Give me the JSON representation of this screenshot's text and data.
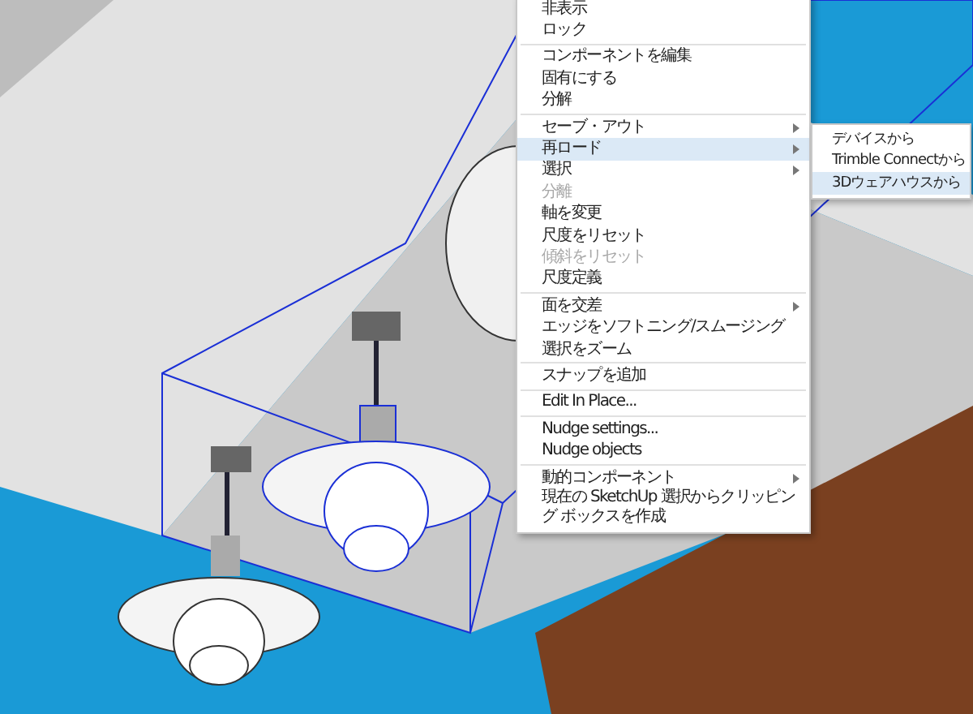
{
  "context_menu": {
    "items": [
      {
        "kind": "item",
        "label": "非表示",
        "submenu": false,
        "disabled": false,
        "selected": false
      },
      {
        "kind": "item",
        "label": "ロック",
        "submenu": false,
        "disabled": false,
        "selected": false
      },
      {
        "kind": "separator"
      },
      {
        "kind": "item",
        "label": "コンポーネントを編集",
        "submenu": false,
        "disabled": false,
        "selected": false
      },
      {
        "kind": "item",
        "label": "固有にする",
        "submenu": false,
        "disabled": false,
        "selected": false
      },
      {
        "kind": "item",
        "label": "分解",
        "submenu": false,
        "disabled": false,
        "selected": false
      },
      {
        "kind": "separator"
      },
      {
        "kind": "item",
        "label": "セーブ・アウト",
        "submenu": true,
        "disabled": false,
        "selected": false
      },
      {
        "kind": "item",
        "label": "再ロード",
        "submenu": true,
        "disabled": false,
        "selected": true
      },
      {
        "kind": "item",
        "label": "選択",
        "submenu": true,
        "disabled": false,
        "selected": false
      },
      {
        "kind": "item",
        "label": "分離",
        "submenu": false,
        "disabled": true,
        "selected": false
      },
      {
        "kind": "item",
        "label": "軸を変更",
        "submenu": false,
        "disabled": false,
        "selected": false
      },
      {
        "kind": "item",
        "label": "尺度をリセット",
        "submenu": false,
        "disabled": false,
        "selected": false
      },
      {
        "kind": "item",
        "label": "傾斜をリセット",
        "submenu": false,
        "disabled": true,
        "selected": false
      },
      {
        "kind": "item",
        "label": "尺度定義",
        "submenu": false,
        "disabled": false,
        "selected": false
      },
      {
        "kind": "separator"
      },
      {
        "kind": "item",
        "label": "面を交差",
        "submenu": true,
        "disabled": false,
        "selected": false
      },
      {
        "kind": "item",
        "label": "エッジをソフトニング/スムージング",
        "submenu": false,
        "disabled": false,
        "selected": false
      },
      {
        "kind": "item",
        "label": "選択をズーム",
        "submenu": false,
        "disabled": false,
        "selected": false
      },
      {
        "kind": "separator"
      },
      {
        "kind": "item",
        "label": "スナップを追加",
        "submenu": false,
        "disabled": false,
        "selected": false
      },
      {
        "kind": "separator"
      },
      {
        "kind": "item",
        "label": "Edit In Place...",
        "submenu": false,
        "disabled": false,
        "selected": false
      },
      {
        "kind": "separator"
      },
      {
        "kind": "item",
        "label": "Nudge settings...",
        "submenu": false,
        "disabled": false,
        "selected": false
      },
      {
        "kind": "item",
        "label": "Nudge objects",
        "submenu": false,
        "disabled": false,
        "selected": false
      },
      {
        "kind": "separator"
      },
      {
        "kind": "item",
        "label": "動的コンポーネント",
        "submenu": true,
        "disabled": false,
        "selected": false
      },
      {
        "kind": "item",
        "label": "現在の SketchUp 選択からクリッピング ボックスを作成",
        "submenu": false,
        "disabled": false,
        "selected": false
      }
    ]
  },
  "submenu": {
    "items": [
      {
        "label": "デバイスから",
        "selected": false
      },
      {
        "label": "Trimble Connectから",
        "selected": false
      },
      {
        "label": "3Dウェアハウスから",
        "selected": true
      }
    ]
  }
}
